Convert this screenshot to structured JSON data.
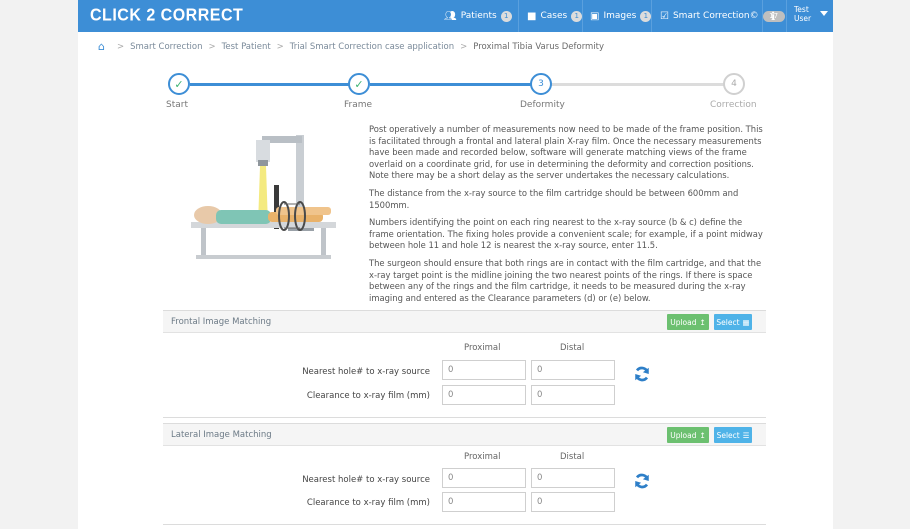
{
  "app": {
    "logo": "CLICK 2 CORRECT"
  },
  "nav": {
    "patients": {
      "label": "Patients",
      "count": "1"
    },
    "cases": {
      "label": "Cases",
      "count": "1"
    },
    "images": {
      "label": "Images",
      "count": "1"
    },
    "smart": {
      "label": "Smart Correction©",
      "count": "17"
    },
    "user_line1": "Test",
    "user_line2": "User"
  },
  "breadcrumb": {
    "items": [
      "Smart Correction",
      "Test Patient",
      "Trial Smart Correction case application"
    ],
    "current": "Proximal Tibia Varus Deformity"
  },
  "stepper": {
    "steps": [
      {
        "label": "Start",
        "state": "done",
        "mark": "✓"
      },
      {
        "label": "Frame",
        "state": "done",
        "mark": "✓"
      },
      {
        "label": "Deformity",
        "state": "current",
        "mark": "3"
      },
      {
        "label": "Correction",
        "state": "todo",
        "mark": "4"
      }
    ]
  },
  "intro": {
    "p1": "Post operatively a number of measurements now need to be made of the frame position. This is facilitated through a frontal and lateral plain X-ray film. Once the necessary measurements have been made and recorded below, software will generate matching views of the frame overlaid on a coordinate grid, for use in determining the deformity and correction positions. Note there may be a short delay as the server undertakes the necessary calculations.",
    "p2": "The distance from the x-ray source to the film cartridge should be between 600mm and 1500mm.",
    "p3": "Numbers identifying the point on each ring nearest to the x-ray source (b & c) define the frame orientation. The fixing holes provide a convenient scale; for example, if a point midway between hole 11 and hole 12 is nearest the x-ray source, enter 11.5.",
    "p4": "The surgeon should ensure that both rings are in contact with the film cartridge, and that the x-ray target point is the midline joining the two nearest points of the rings. If there is space between any of the rings and the film cartridge, it needs to be measured during the x-ray imaging and entered as the Clearance parameters (d) or (e) below."
  },
  "frontal": {
    "title": "Frontal Image Matching",
    "upload": "Upload",
    "select": "Select",
    "col_proximal": "Proximal",
    "col_distal": "Distal",
    "row1_label": "Nearest hole# to x-ray source",
    "row2_label": "Clearance to x-ray film (mm)",
    "nearest_proximal": "0",
    "nearest_distal": "0",
    "clearance_proximal": "0",
    "clearance_distal": "0"
  },
  "lateral": {
    "title": "Lateral Image Matching",
    "upload": "Upload",
    "select": "Select",
    "col_proximal": "Proximal",
    "col_distal": "Distal",
    "row1_label": "Nearest hole# to x-ray source",
    "row2_label": "Clearance to x-ray film (mm)",
    "nearest_proximal": "0",
    "nearest_distal": "0",
    "clearance_proximal": "0",
    "clearance_distal": "0"
  },
  "colors": {
    "primary": "#3d8ed6",
    "success": "#6cc070",
    "info": "#4fb3e8",
    "done_check": "#3cb371"
  },
  "icons": [
    "home-icon",
    "patients-icon",
    "cases-icon",
    "images-icon",
    "smart-correction-icon",
    "info-icon",
    "caret-down-icon",
    "upload-icon",
    "select-icon",
    "refresh-icon",
    "check-icon"
  ]
}
